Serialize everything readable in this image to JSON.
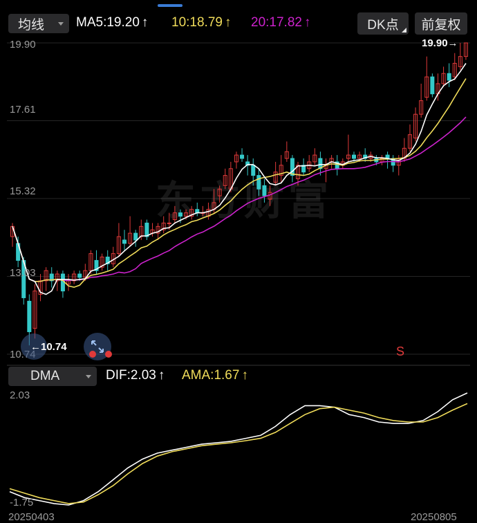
{
  "toolbar": {
    "ma_selector": "均线",
    "ma5": "MA5:19.20",
    "ma10": "10:18.79",
    "ma20": "20:17.82",
    "arrow": "↑",
    "dk_button": "DK点",
    "adjust_button": "前复权"
  },
  "main_chart": {
    "price_labels": [
      "19.90",
      "17.61",
      "15.32",
      "13.03",
      "10.74"
    ],
    "last_price_tag": "19.90→",
    "low_marker": "10.74",
    "signal_mark": "S"
  },
  "indicator": {
    "selector": "DMA",
    "dif": "DIF:2.03",
    "ama": "AMA:1.67",
    "arrow": "↑",
    "top_label": "2.03",
    "bottom_label": "-1.75"
  },
  "dates": {
    "start": "20250403",
    "end": "20250805"
  },
  "colors": {
    "up": "#e03a3a",
    "down": "#35c9c9",
    "ma5": "#ffffff",
    "ma10": "#f0dc5a",
    "ma20": "#cc22cc",
    "dif": "#ffffff",
    "ama": "#f0dc5a",
    "grid": "#262626",
    "accent": "#3a7bd5"
  },
  "chart_data": [
    {
      "type": "candlestick",
      "title": "",
      "ylim": [
        10.74,
        19.9
      ],
      "y_ticks": [
        19.9,
        17.61,
        15.32,
        13.03,
        10.74
      ],
      "x_range": [
        "20250403",
        "20250805"
      ],
      "grid": true,
      "series": [
        {
          "name": "MA5",
          "last": 19.2
        },
        {
          "name": "10",
          "last": 18.79
        },
        {
          "name": "20",
          "last": 17.82
        }
      ],
      "candles": [
        [
          14.2,
          14.5,
          14.6,
          13.9
        ],
        [
          14.0,
          13.5,
          14.2,
          13.3
        ],
        [
          13.5,
          12.4,
          13.6,
          12.2
        ],
        [
          12.3,
          11.4,
          12.5,
          11.0
        ],
        [
          11.5,
          12.6,
          12.8,
          11.2
        ],
        [
          12.5,
          12.9,
          13.1,
          12.3
        ],
        [
          12.9,
          13.2,
          13.3,
          12.6
        ],
        [
          13.1,
          12.9,
          13.3,
          12.7
        ],
        [
          12.9,
          13.1,
          13.2,
          12.6
        ],
        [
          13.1,
          12.6,
          13.2,
          12.4
        ],
        [
          12.8,
          12.9,
          13.1,
          12.6
        ],
        [
          12.9,
          13.1,
          13.2,
          12.8
        ],
        [
          13.1,
          13.0,
          13.2,
          12.9
        ],
        [
          13.0,
          13.2,
          13.4,
          12.9
        ],
        [
          13.2,
          13.7,
          13.8,
          13.1
        ],
        [
          13.5,
          13.2,
          13.8,
          13.1
        ],
        [
          13.3,
          13.6,
          13.7,
          13.2
        ],
        [
          13.6,
          13.4,
          13.8,
          13.2
        ],
        [
          13.4,
          13.7,
          13.9,
          13.3
        ],
        [
          13.7,
          14.2,
          14.6,
          13.6
        ],
        [
          14.1,
          14.0,
          14.4,
          13.8
        ],
        [
          14.0,
          14.3,
          14.8,
          13.9
        ],
        [
          14.3,
          14.1,
          14.4,
          13.9
        ],
        [
          14.2,
          14.5,
          14.7,
          14.1
        ],
        [
          14.6,
          14.2,
          14.7,
          14.1
        ],
        [
          14.3,
          14.4,
          14.6,
          14.2
        ],
        [
          14.3,
          14.5,
          14.6,
          14.1
        ],
        [
          14.4,
          14.6,
          14.8,
          14.3
        ],
        [
          14.6,
          14.6,
          14.9,
          14.4
        ],
        [
          14.7,
          14.9,
          15.1,
          14.6
        ],
        [
          14.9,
          14.8,
          15.0,
          14.6
        ],
        [
          14.8,
          14.9,
          15.0,
          14.7
        ],
        [
          14.8,
          15.0,
          15.1,
          14.7
        ],
        [
          15.0,
          14.9,
          15.2,
          14.8
        ],
        [
          14.9,
          14.9,
          15.1,
          14.8
        ],
        [
          14.8,
          15.0,
          15.2,
          14.7
        ],
        [
          15.0,
          15.2,
          15.6,
          14.9
        ],
        [
          15.4,
          15.6,
          15.7,
          15.2
        ],
        [
          15.7,
          16.0,
          16.2,
          15.6
        ],
        [
          15.6,
          16.2,
          16.4,
          15.5
        ],
        [
          16.4,
          16.6,
          16.7,
          16.2
        ],
        [
          16.6,
          16.5,
          16.8,
          16.4
        ],
        [
          16.4,
          16.3,
          16.6,
          16.0
        ],
        [
          16.3,
          16.0,
          16.5,
          15.7
        ],
        [
          16.0,
          15.6,
          16.2,
          15.4
        ],
        [
          15.7,
          15.4,
          15.9,
          15.2
        ],
        [
          15.3,
          15.5,
          15.7,
          15.1
        ],
        [
          15.8,
          16.1,
          16.4,
          15.7
        ],
        [
          16.0,
          16.3,
          16.6,
          15.8
        ],
        [
          16.5,
          16.7,
          17.0,
          16.4
        ],
        [
          16.5,
          16.0,
          16.6,
          15.8
        ],
        [
          15.9,
          16.3,
          16.4,
          15.7
        ],
        [
          16.3,
          16.1,
          16.5,
          16.0
        ],
        [
          16.2,
          16.4,
          16.6,
          16.1
        ],
        [
          16.4,
          16.6,
          16.8,
          16.3
        ],
        [
          16.5,
          16.2,
          16.7,
          16.0
        ],
        [
          16.2,
          16.3,
          16.5,
          15.8
        ],
        [
          16.4,
          16.5,
          16.6,
          16.2
        ],
        [
          16.4,
          16.2,
          16.6,
          16.0
        ],
        [
          16.3,
          16.4,
          16.5,
          16.2
        ],
        [
          16.5,
          16.6,
          17.2,
          16.4
        ],
        [
          16.6,
          16.5,
          16.7,
          16.4
        ],
        [
          16.5,
          16.6,
          16.7,
          16.4
        ],
        [
          16.6,
          16.5,
          16.8,
          16.4
        ],
        [
          16.5,
          16.6,
          16.7,
          16.4
        ],
        [
          16.5,
          16.4,
          16.6,
          16.3
        ],
        [
          16.4,
          16.5,
          16.6,
          16.3
        ],
        [
          16.6,
          16.5,
          16.7,
          16.2
        ],
        [
          16.5,
          16.3,
          16.6,
          16.1
        ],
        [
          16.3,
          16.5,
          16.6,
          16.0
        ],
        [
          16.5,
          16.8,
          17.1,
          16.4
        ],
        [
          16.8,
          17.2,
          17.5,
          16.7
        ],
        [
          17.1,
          17.8,
          18.0,
          17.0
        ],
        [
          17.8,
          18.2,
          18.7,
          17.7
        ],
        [
          18.3,
          18.9,
          19.5,
          18.2
        ],
        [
          18.9,
          18.4,
          19.0,
          18.3
        ],
        [
          18.4,
          18.7,
          19.0,
          18.2
        ],
        [
          18.7,
          19.0,
          19.2,
          18.6
        ],
        [
          19.0,
          18.8,
          19.3,
          18.6
        ],
        [
          18.9,
          19.3,
          19.6,
          18.8
        ],
        [
          19.2,
          19.5,
          19.9,
          19.1
        ],
        [
          19.5,
          19.9,
          19.9,
          19.4
        ]
      ]
    },
    {
      "type": "line",
      "title": "DMA",
      "ylim": [
        -1.75,
        2.03
      ],
      "x_range": [
        "20250403",
        "20250805"
      ],
      "series": [
        {
          "name": "DIF",
          "values": [
            -1.3,
            -1.5,
            -1.6,
            -1.7,
            -1.75,
            -1.6,
            -1.3,
            -0.9,
            -0.5,
            -0.2,
            0.0,
            0.1,
            0.2,
            0.3,
            0.35,
            0.4,
            0.5,
            0.6,
            0.9,
            1.3,
            1.6,
            1.6,
            1.55,
            1.3,
            1.2,
            1.05,
            1.0,
            1.0,
            1.1,
            1.4,
            1.8,
            2.03
          ]
        },
        {
          "name": "AMA",
          "values": [
            -1.2,
            -1.35,
            -1.5,
            -1.6,
            -1.7,
            -1.65,
            -1.4,
            -1.1,
            -0.7,
            -0.35,
            -0.1,
            0.05,
            0.15,
            0.25,
            0.3,
            0.35,
            0.42,
            0.5,
            0.7,
            1.0,
            1.3,
            1.5,
            1.55,
            1.45,
            1.35,
            1.2,
            1.1,
            1.05,
            1.05,
            1.2,
            1.45,
            1.67
          ]
        }
      ]
    }
  ]
}
